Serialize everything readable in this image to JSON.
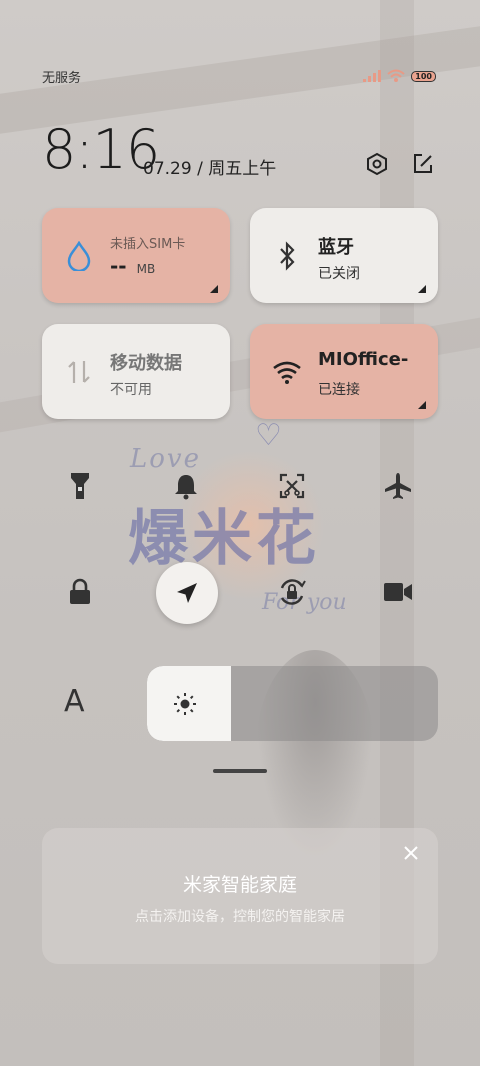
{
  "status_bar": {
    "carrier": "无服务",
    "battery": "100"
  },
  "clock": {
    "time": "8:16",
    "date": "07.29 / 周五上午"
  },
  "tiles": {
    "data_usage": {
      "title": "未插入SIM卡",
      "value": "--",
      "unit": "MB"
    },
    "bluetooth": {
      "title": "蓝牙",
      "status": "已关闭"
    },
    "mobile_data": {
      "title": "移动数据",
      "status": "不可用"
    },
    "wifi": {
      "title": "MIOffice-",
      "status": "已连接"
    }
  },
  "brightness": {
    "level": 0.29
  },
  "font_button": "A",
  "card": {
    "title": "米家智能家庭",
    "subtitle": "点击添加设备，控制您的智能家居"
  },
  "colors": {
    "salmon_tile": "#e5b3a5",
    "cream_tile": "#efedea",
    "accent_blue": "#3a8fd8"
  }
}
